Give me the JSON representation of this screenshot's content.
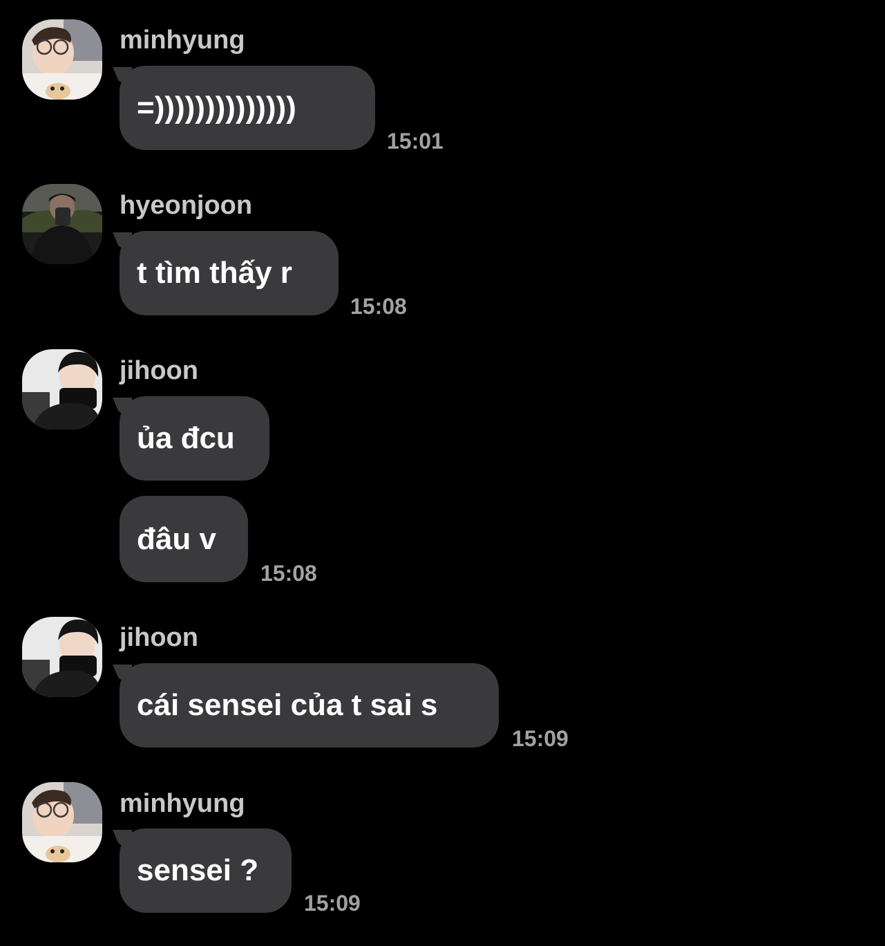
{
  "messages": [
    {
      "sender": "minhyung",
      "avatar": "minhyung-avatar",
      "texts": [
        "=))))))))))))))"
      ],
      "time": "15:01"
    },
    {
      "sender": "hyeonjoon",
      "avatar": "hyeonjoon-avatar",
      "texts": [
        "t tìm thấy r"
      ],
      "time": "15:08"
    },
    {
      "sender": "jihoon",
      "avatar": "jihoon-avatar",
      "texts": [
        "ủa đcu",
        "đâu v"
      ],
      "time": "15:08"
    },
    {
      "sender": "jihoon",
      "avatar": "jihoon-avatar",
      "texts": [
        "cái sensei của t sai s"
      ],
      "time": "15:09"
    },
    {
      "sender": "minhyung",
      "avatar": "minhyung-avatar",
      "texts": [
        "sensei ?"
      ],
      "time": "15:09"
    }
  ],
  "colors": {
    "background": "#000000",
    "bubble": "#3a3a3c",
    "message_text": "#ffffff",
    "sender_text": "#c8c8c8",
    "time_text": "#a2a2a2"
  }
}
